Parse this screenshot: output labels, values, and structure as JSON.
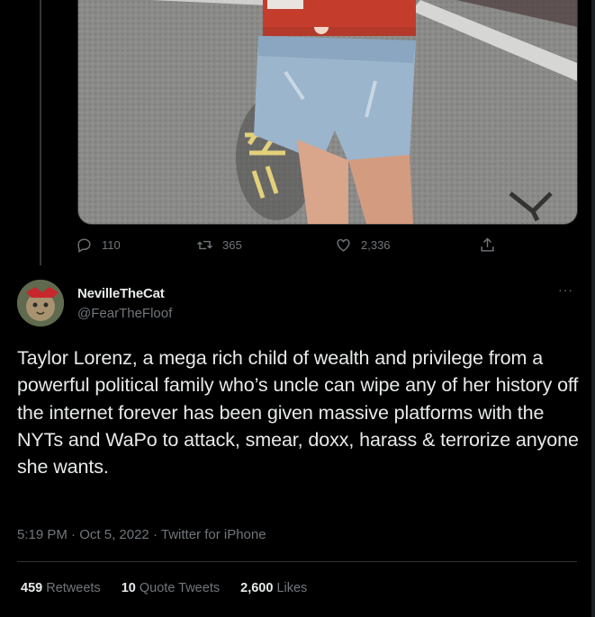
{
  "tweet_actions": {
    "replies": "110",
    "retweets": "365",
    "likes": "2,336"
  },
  "user": {
    "display_name": "NevilleTheCat",
    "handle": "@FearTheFloof",
    "more_label": "···"
  },
  "tweet": {
    "text": "Taylor Lorenz, a mega rich child of wealth and privilege from a powerful political family who’s uncle can wipe any of her history off the internet forever has been given massive platforms with the NYTs and WaPo to attack, smear, doxx, harass & terrorize anyone she wants.",
    "time": "5:19 PM",
    "date": "Oct 5, 2022",
    "source": "Twitter for iPhone",
    "separator": "·"
  },
  "stats": {
    "retweets_count": "459",
    "retweets_label": "Retweets",
    "quotes_count": "10",
    "quotes_label": "Quote Tweets",
    "likes_count": "2,600",
    "likes_label": "Likes"
  },
  "icons": {
    "reply": "reply-icon",
    "retweet": "retweet-icon",
    "like": "heart-icon",
    "share": "share-icon"
  },
  "colors": {
    "background": "#000000",
    "text_primary": "#e7e9ea",
    "text_secondary": "#71767b",
    "divider": "#2f3336"
  }
}
